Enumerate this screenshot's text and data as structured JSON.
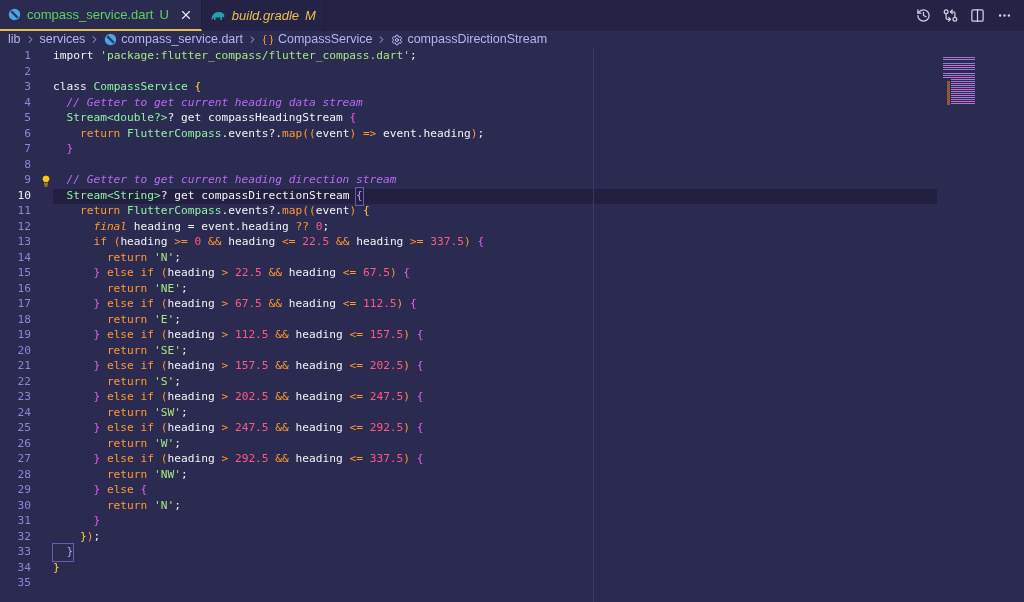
{
  "tabs": [
    {
      "label": "compass_service.dart",
      "badge": "U",
      "selected": true,
      "preview": false,
      "kind": "dart",
      "color": "#5fd35a"
    },
    {
      "label": "build.gradle",
      "badge": "M",
      "selected": false,
      "preview": true,
      "kind": "gradle",
      "color": "#e8c14a"
    }
  ],
  "breadcrumb": [
    {
      "label": "lib"
    },
    {
      "label": "services"
    },
    {
      "label": "compass_service.dart",
      "kind": "dart"
    },
    {
      "label": "CompassService",
      "kind": "class"
    },
    {
      "label": "compassDirectionStream",
      "kind": "method"
    }
  ],
  "lines": [
    {
      "n": "1",
      "tokens": [
        {
          "t": "import ",
          "kind": "plain"
        },
        {
          "t": "'package:flutter_compass/flutter_compass.dart'",
          "kind": "string"
        },
        {
          "t": ";",
          "kind": "plain"
        }
      ]
    },
    {
      "n": "2"
    },
    {
      "n": "3",
      "tokens": [
        {
          "t": "class ",
          "kind": "plain"
        },
        {
          "t": "CompassService ",
          "kind": "type"
        },
        {
          "t": "{",
          "kind": "bracket"
        }
      ]
    },
    {
      "n": "4",
      "tokens": [
        {
          "t": "  // Getter to get current heading data stream",
          "kind": "comment"
        }
      ]
    },
    {
      "n": "5",
      "tokens": [
        {
          "t": "  Stream<double?>",
          "kind": "type"
        },
        {
          "t": "? get compassHeadingStream ",
          "kind": "plain"
        },
        {
          "t": "{",
          "kind": "brace"
        }
      ]
    },
    {
      "n": "6",
      "tokens": [
        {
          "t": "    return ",
          "kind": "keyword"
        },
        {
          "t": "FlutterCompass",
          "kind": "type"
        },
        {
          "t": ".events?.",
          "kind": "plain"
        },
        {
          "t": "map",
          "kind": "function"
        },
        {
          "t": "((",
          "kind": "operator"
        },
        {
          "t": "event",
          "kind": "plain"
        },
        {
          "t": ") => ",
          "kind": "operator"
        },
        {
          "t": "event.heading",
          "kind": "plain"
        },
        {
          "t": ")",
          "kind": "operator"
        },
        {
          "t": ";",
          "kind": "plain"
        }
      ]
    },
    {
      "n": "7",
      "tokens": [
        {
          "t": "  }",
          "kind": "brace"
        }
      ]
    },
    {
      "n": "8"
    },
    {
      "n": "9",
      "hint": true,
      "tokens": [
        {
          "t": "  // Getter to get current heading direction stream",
          "kind": "comment"
        }
      ]
    },
    {
      "n": "10",
      "current": true,
      "tokens": [
        {
          "t": "  Stream<String>",
          "kind": "type"
        },
        {
          "t": "? get compassDirectionStream ",
          "kind": "plain"
        },
        {
          "t": "{",
          "kind": "match"
        }
      ]
    },
    {
      "n": "11",
      "tokens": [
        {
          "t": "    return ",
          "kind": "keyword"
        },
        {
          "t": "FlutterCompass",
          "kind": "type"
        },
        {
          "t": ".events?.",
          "kind": "plain"
        },
        {
          "t": "map",
          "kind": "function"
        },
        {
          "t": "((",
          "kind": "operator"
        },
        {
          "t": "event",
          "kind": "plain"
        },
        {
          "t": ") ",
          "kind": "operator"
        },
        {
          "t": "{",
          "kind": "bracket"
        }
      ]
    },
    {
      "n": "12",
      "tokens": [
        {
          "t": "      final",
          "kind": "modifier"
        },
        {
          "t": " heading = event.heading ",
          "kind": "plain"
        },
        {
          "t": "?? ",
          "kind": "operator"
        },
        {
          "t": "0",
          "kind": "number"
        },
        {
          "t": ";",
          "kind": "plain"
        }
      ]
    },
    {
      "n": "13",
      "tokens": [
        {
          "t": "      if ",
          "kind": "keyword"
        },
        {
          "t": "(",
          "kind": "operator"
        },
        {
          "t": "heading ",
          "kind": "plain"
        },
        {
          "t": ">= ",
          "kind": "operator"
        },
        {
          "t": "0 ",
          "kind": "number"
        },
        {
          "t": "&& ",
          "kind": "operator"
        },
        {
          "t": "heading ",
          "kind": "plain"
        },
        {
          "t": "<= ",
          "kind": "operator"
        },
        {
          "t": "22.5 ",
          "kind": "number"
        },
        {
          "t": "&& ",
          "kind": "operator"
        },
        {
          "t": "heading ",
          "kind": "plain"
        },
        {
          "t": ">= ",
          "kind": "operator"
        },
        {
          "t": "337.5",
          "kind": "number"
        },
        {
          "t": ") ",
          "kind": "operator"
        },
        {
          "t": "{",
          "kind": "brace"
        }
      ]
    },
    {
      "n": "14",
      "tokens": [
        {
          "t": "        return ",
          "kind": "keyword"
        },
        {
          "t": "'N'",
          "kind": "string"
        },
        {
          "t": ";",
          "kind": "plain"
        }
      ]
    },
    {
      "n": "15",
      "tokens": [
        {
          "t": "      } ",
          "kind": "brace"
        },
        {
          "t": "else if ",
          "kind": "keyword"
        },
        {
          "t": "(",
          "kind": "operator"
        },
        {
          "t": "heading ",
          "kind": "plain"
        },
        {
          "t": "> ",
          "kind": "operator"
        },
        {
          "t": "22.5 ",
          "kind": "number"
        },
        {
          "t": "&& ",
          "kind": "operator"
        },
        {
          "t": "heading ",
          "kind": "plain"
        },
        {
          "t": "<= ",
          "kind": "operator"
        },
        {
          "t": "67.5",
          "kind": "number"
        },
        {
          "t": ") ",
          "kind": "operator"
        },
        {
          "t": "{",
          "kind": "brace"
        }
      ]
    },
    {
      "n": "16",
      "tokens": [
        {
          "t": "        return ",
          "kind": "keyword"
        },
        {
          "t": "'NE'",
          "kind": "string"
        },
        {
          "t": ";",
          "kind": "plain"
        }
      ]
    },
    {
      "n": "17",
      "tokens": [
        {
          "t": "      } ",
          "kind": "brace"
        },
        {
          "t": "else if ",
          "kind": "keyword"
        },
        {
          "t": "(",
          "kind": "operator"
        },
        {
          "t": "heading ",
          "kind": "plain"
        },
        {
          "t": "> ",
          "kind": "operator"
        },
        {
          "t": "67.5 ",
          "kind": "number"
        },
        {
          "t": "&& ",
          "kind": "operator"
        },
        {
          "t": "heading ",
          "kind": "plain"
        },
        {
          "t": "<= ",
          "kind": "operator"
        },
        {
          "t": "112.5",
          "kind": "number"
        },
        {
          "t": ") ",
          "kind": "operator"
        },
        {
          "t": "{",
          "kind": "brace"
        }
      ]
    },
    {
      "n": "18",
      "tokens": [
        {
          "t": "        return ",
          "kind": "keyword"
        },
        {
          "t": "'E'",
          "kind": "string"
        },
        {
          "t": ";",
          "kind": "plain"
        }
      ]
    },
    {
      "n": "19",
      "tokens": [
        {
          "t": "      } ",
          "kind": "brace"
        },
        {
          "t": "else if ",
          "kind": "keyword"
        },
        {
          "t": "(",
          "kind": "operator"
        },
        {
          "t": "heading ",
          "kind": "plain"
        },
        {
          "t": "> ",
          "kind": "operator"
        },
        {
          "t": "112.5 ",
          "kind": "number"
        },
        {
          "t": "&& ",
          "kind": "operator"
        },
        {
          "t": "heading ",
          "kind": "plain"
        },
        {
          "t": "<= ",
          "kind": "operator"
        },
        {
          "t": "157.5",
          "kind": "number"
        },
        {
          "t": ") ",
          "kind": "operator"
        },
        {
          "t": "{",
          "kind": "brace"
        }
      ]
    },
    {
      "n": "20",
      "tokens": [
        {
          "t": "        return ",
          "kind": "keyword"
        },
        {
          "t": "'SE'",
          "kind": "string"
        },
        {
          "t": ";",
          "kind": "plain"
        }
      ]
    },
    {
      "n": "21",
      "tokens": [
        {
          "t": "      } ",
          "kind": "brace"
        },
        {
          "t": "else if ",
          "kind": "keyword"
        },
        {
          "t": "(",
          "kind": "operator"
        },
        {
          "t": "heading ",
          "kind": "plain"
        },
        {
          "t": "> ",
          "kind": "operator"
        },
        {
          "t": "157.5 ",
          "kind": "number"
        },
        {
          "t": "&& ",
          "kind": "operator"
        },
        {
          "t": "heading ",
          "kind": "plain"
        },
        {
          "t": "<= ",
          "kind": "operator"
        },
        {
          "t": "202.5",
          "kind": "number"
        },
        {
          "t": ") ",
          "kind": "operator"
        },
        {
          "t": "{",
          "kind": "brace"
        }
      ]
    },
    {
      "n": "22",
      "tokens": [
        {
          "t": "        return ",
          "kind": "keyword"
        },
        {
          "t": "'S'",
          "kind": "string"
        },
        {
          "t": ";",
          "kind": "plain"
        }
      ]
    },
    {
      "n": "23",
      "tokens": [
        {
          "t": "      } ",
          "kind": "brace"
        },
        {
          "t": "else if ",
          "kind": "keyword"
        },
        {
          "t": "(",
          "kind": "operator"
        },
        {
          "t": "heading ",
          "kind": "plain"
        },
        {
          "t": "> ",
          "kind": "operator"
        },
        {
          "t": "202.5 ",
          "kind": "number"
        },
        {
          "t": "&& ",
          "kind": "operator"
        },
        {
          "t": "heading ",
          "kind": "plain"
        },
        {
          "t": "<= ",
          "kind": "operator"
        },
        {
          "t": "247.5",
          "kind": "number"
        },
        {
          "t": ") ",
          "kind": "operator"
        },
        {
          "t": "{",
          "kind": "brace"
        }
      ]
    },
    {
      "n": "24",
      "tokens": [
        {
          "t": "        return ",
          "kind": "keyword"
        },
        {
          "t": "'SW'",
          "kind": "string"
        },
        {
          "t": ";",
          "kind": "plain"
        }
      ]
    },
    {
      "n": "25",
      "tokens": [
        {
          "t": "      } ",
          "kind": "brace"
        },
        {
          "t": "else if ",
          "kind": "keyword"
        },
        {
          "t": "(",
          "kind": "operator"
        },
        {
          "t": "heading ",
          "kind": "plain"
        },
        {
          "t": "> ",
          "kind": "operator"
        },
        {
          "t": "247.5 ",
          "kind": "number"
        },
        {
          "t": "&& ",
          "kind": "operator"
        },
        {
          "t": "heading ",
          "kind": "plain"
        },
        {
          "t": "<= ",
          "kind": "operator"
        },
        {
          "t": "292.5",
          "kind": "number"
        },
        {
          "t": ") ",
          "kind": "operator"
        },
        {
          "t": "{",
          "kind": "brace"
        }
      ]
    },
    {
      "n": "26",
      "tokens": [
        {
          "t": "        return ",
          "kind": "keyword"
        },
        {
          "t": "'W'",
          "kind": "string"
        },
        {
          "t": ";",
          "kind": "plain"
        }
      ]
    },
    {
      "n": "27",
      "tokens": [
        {
          "t": "      } ",
          "kind": "brace"
        },
        {
          "t": "else if ",
          "kind": "keyword"
        },
        {
          "t": "(",
          "kind": "operator"
        },
        {
          "t": "heading ",
          "kind": "plain"
        },
        {
          "t": "> ",
          "kind": "operator"
        },
        {
          "t": "292.5 ",
          "kind": "number"
        },
        {
          "t": "&& ",
          "kind": "operator"
        },
        {
          "t": "heading ",
          "kind": "plain"
        },
        {
          "t": "<= ",
          "kind": "operator"
        },
        {
          "t": "337.5",
          "kind": "number"
        },
        {
          "t": ") ",
          "kind": "operator"
        },
        {
          "t": "{",
          "kind": "brace"
        }
      ]
    },
    {
      "n": "28",
      "tokens": [
        {
          "t": "        return ",
          "kind": "keyword"
        },
        {
          "t": "'NW'",
          "kind": "string"
        },
        {
          "t": ";",
          "kind": "plain"
        }
      ]
    },
    {
      "n": "29",
      "tokens": [
        {
          "t": "      } ",
          "kind": "brace"
        },
        {
          "t": "else ",
          "kind": "keyword"
        },
        {
          "t": "{",
          "kind": "brace"
        }
      ]
    },
    {
      "n": "30",
      "tokens": [
        {
          "t": "        return ",
          "kind": "keyword"
        },
        {
          "t": "'N'",
          "kind": "string"
        },
        {
          "t": ";",
          "kind": "plain"
        }
      ]
    },
    {
      "n": "31",
      "tokens": [
        {
          "t": "      }",
          "kind": "brace"
        }
      ]
    },
    {
      "n": "32",
      "tokens": [
        {
          "t": "    }",
          "kind": "bracket"
        },
        {
          "t": ")",
          "kind": "operator"
        },
        {
          "t": ";",
          "kind": "plain"
        }
      ]
    },
    {
      "n": "33",
      "tokens": [
        {
          "t": "  }",
          "kind": "match"
        }
      ]
    },
    {
      "n": "34",
      "tokens": [
        {
          "t": "}",
          "kind": "bracket"
        }
      ]
    },
    {
      "n": "35"
    }
  ]
}
